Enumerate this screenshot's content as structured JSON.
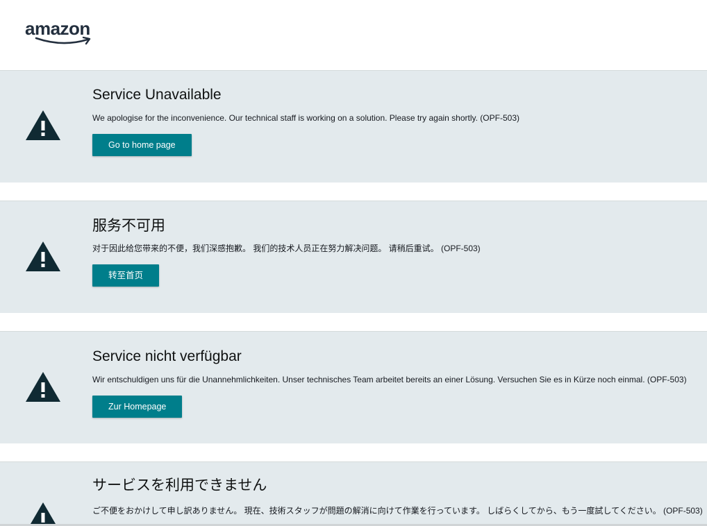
{
  "header": {
    "logo_text": "amazon"
  },
  "colors": {
    "panel_bg": "#e3eaed",
    "button_bg": "#007e8b",
    "icon_color": "#102a33"
  },
  "icons": {
    "warning": "warning-triangle-icon"
  },
  "sections": [
    {
      "title": "Service Unavailable",
      "message": "We apologise for the inconvenience. Our technical staff is working on a solution. Please try again shortly. (OPF-503)",
      "button_label": "Go to home page"
    },
    {
      "title": "服务不可用",
      "message": "对于因此给您带来的不便，我们深感抱歉。 我们的技术人员正在努力解决问题。 请稍后重试。 (OPF-503)",
      "button_label": "转至首页"
    },
    {
      "title": "Service nicht verfügbar",
      "message": "Wir entschuldigen uns für die Unannehmlichkeiten. Unser technisches Team arbeitet bereits an einer Lösung. Versuchen Sie es in Kürze noch einmal. (OPF-503)",
      "button_label": "Zur Homepage"
    },
    {
      "title": "サービスを利用できません",
      "message": "ご不便をおかけして申し訳ありません。 現在、技術スタッフが問題の解消に向けて作業を行っています。 しばらくしてから、もう一度試してください。 (OPF-503)"
    }
  ]
}
